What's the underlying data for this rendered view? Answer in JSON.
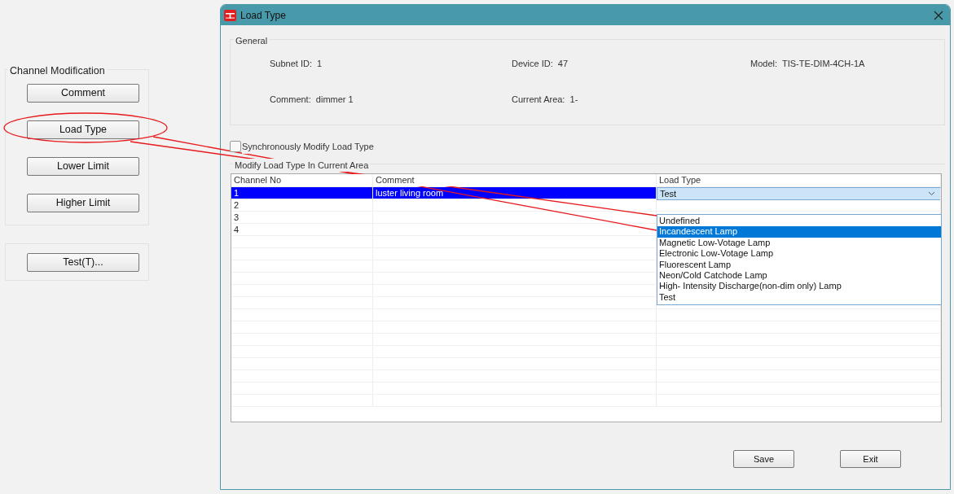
{
  "left_panel": {
    "group_title": "Channel Modification",
    "buttons": [
      "Comment",
      "Load Type",
      "Lower Limit",
      "Higher Limit"
    ],
    "test_button": "Test(T)..."
  },
  "dialog": {
    "title": "Load Type",
    "general": {
      "title": "General",
      "fields": [
        {
          "label": "Subnet ID:",
          "value": "1"
        },
        {
          "label": "Device ID:",
          "value": "47"
        },
        {
          "label": "Model:",
          "value": "TIS-TE-DIM-4CH-1A"
        },
        {
          "label": "Comment:",
          "value": "dimmer 1"
        },
        {
          "label": "Current Area:",
          "value": "1-"
        }
      ]
    },
    "sync_checkbox": {
      "label": "Synchronously Modify Load Type",
      "checked": false
    },
    "area_group": {
      "title": "Modify Load Type In Current Area"
    },
    "table": {
      "columns": [
        "Channel No",
        "Comment",
        "Load Type"
      ],
      "rows": [
        {
          "channel_no": "1",
          "comment": "luster living room",
          "load_type": "Test",
          "selected": true
        },
        {
          "channel_no": "2",
          "selected": false
        },
        {
          "channel_no": "3",
          "selected": false
        },
        {
          "channel_no": "4",
          "selected": false
        }
      ]
    },
    "dropdown": {
      "options": [
        {
          "label": "Undefined",
          "selected": false
        },
        {
          "label": "Incandescent Lamp",
          "selected": true
        },
        {
          "label": "Magnetic Low-Votage Lamp",
          "selected": false
        },
        {
          "label": "Electronic Low-Votage Lamp",
          "selected": false
        },
        {
          "label": "Fluorescent Lamp",
          "selected": false
        },
        {
          "label": "Neon/Cold Catchode Lamp",
          "selected": false
        },
        {
          "label": "High- Intensity Discharge(non-dim only) Lamp",
          "selected": false
        },
        {
          "label": "Test",
          "selected": false
        }
      ]
    },
    "buttons": [
      "Save",
      "Exit"
    ]
  }
}
